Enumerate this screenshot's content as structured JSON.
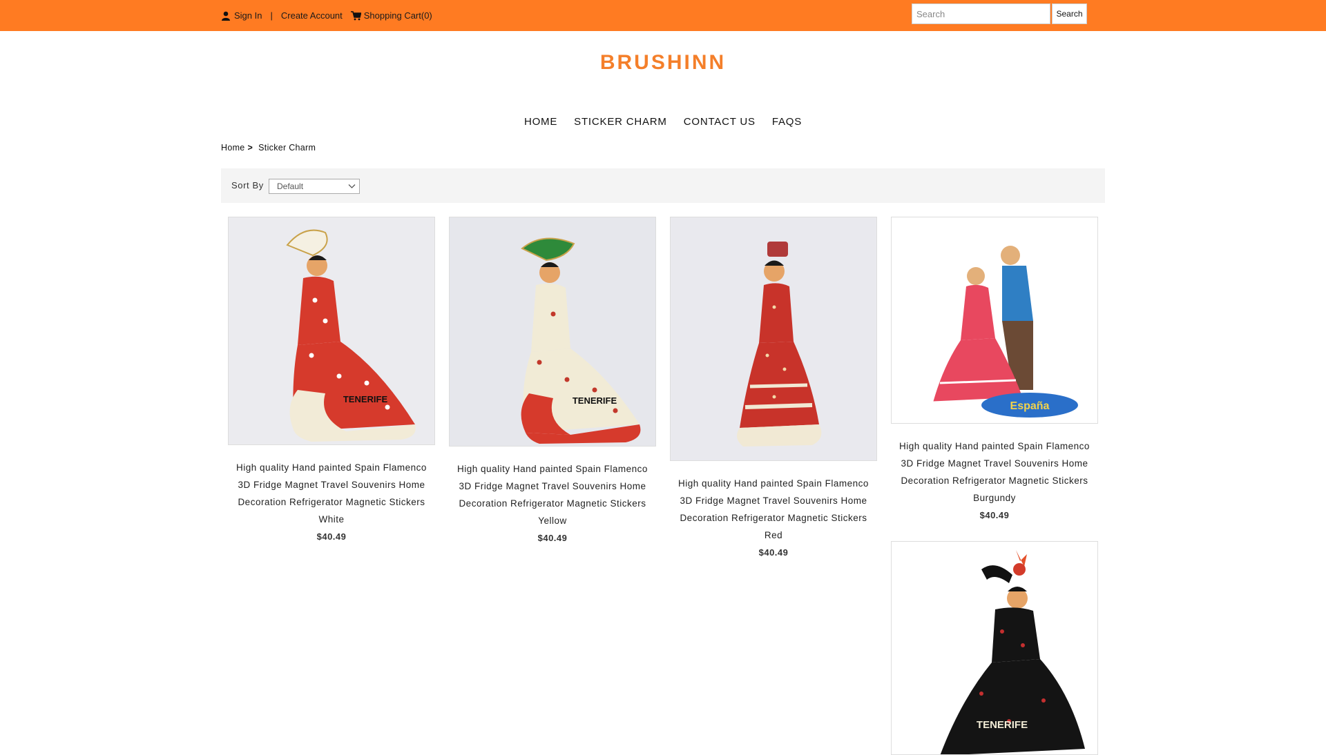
{
  "header": {
    "sign_in": "Sign In",
    "separator": "|",
    "create_account": "Create Account",
    "cart": "Shopping Cart(0)",
    "search_placeholder": "Search",
    "search_button": "Search",
    "bar_color": "#ff7b22"
  },
  "logo": {
    "text": "BRUSHINN",
    "color": "#f47f2a"
  },
  "nav": {
    "items": [
      "HOME",
      "STICKER CHARM",
      "CONTACT US",
      "FAQS"
    ]
  },
  "breadcrumb": {
    "home": "Home",
    "arrow": ">",
    "current": "Sticker Charm"
  },
  "sort": {
    "label": "Sort By",
    "selected": "Default"
  },
  "products": [
    {
      "title": "High quality Hand painted Spain Flamenco 3D Fridge Magnet Travel Souvenirs Home Decoration Refrigerator Magnetic Stickers White",
      "price": "$40.49",
      "image_text": "TENERIFE"
    },
    {
      "title": "High quality Hand painted Spain Flamenco 3D Fridge Magnet Travel Souvenirs Home Decoration Refrigerator Magnetic Stickers Yellow",
      "price": "$40.49",
      "image_text": "TENERIFE"
    },
    {
      "title": "High quality Hand painted Spain Flamenco 3D Fridge Magnet Travel Souvenirs Home Decoration Refrigerator Magnetic Stickers Red",
      "price": "$40.49",
      "image_text": ""
    },
    {
      "title": "High quality Hand painted Spain Flamenco 3D Fridge Magnet Travel Souvenirs Home Decoration Refrigerator Magnetic Stickers Burgundy",
      "price": "$40.49",
      "image_text": "España"
    },
    {
      "title": "",
      "price": "",
      "image_text": "TENERIFE"
    }
  ]
}
